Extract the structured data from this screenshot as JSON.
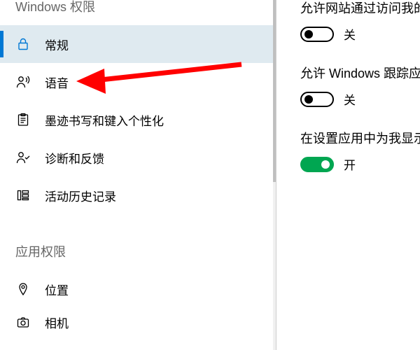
{
  "sidebar": {
    "section1_title": "Windows 权限",
    "section2_title": "应用权限",
    "items": [
      {
        "label": "常规"
      },
      {
        "label": "语音"
      },
      {
        "label": "墨迹书写和键入个性化"
      },
      {
        "label": "诊断和反馈"
      },
      {
        "label": "活动历史记录"
      }
    ],
    "items2": [
      {
        "label": "位置"
      },
      {
        "label": "相机"
      }
    ]
  },
  "content": {
    "settings": [
      {
        "label": "允许网站通过访问我的",
        "state": "关",
        "on": false
      },
      {
        "label": "允许 Windows 跟踪应",
        "state": "关",
        "on": false
      },
      {
        "label": "在设置应用中为我显示",
        "state": "开",
        "on": true
      }
    ]
  }
}
